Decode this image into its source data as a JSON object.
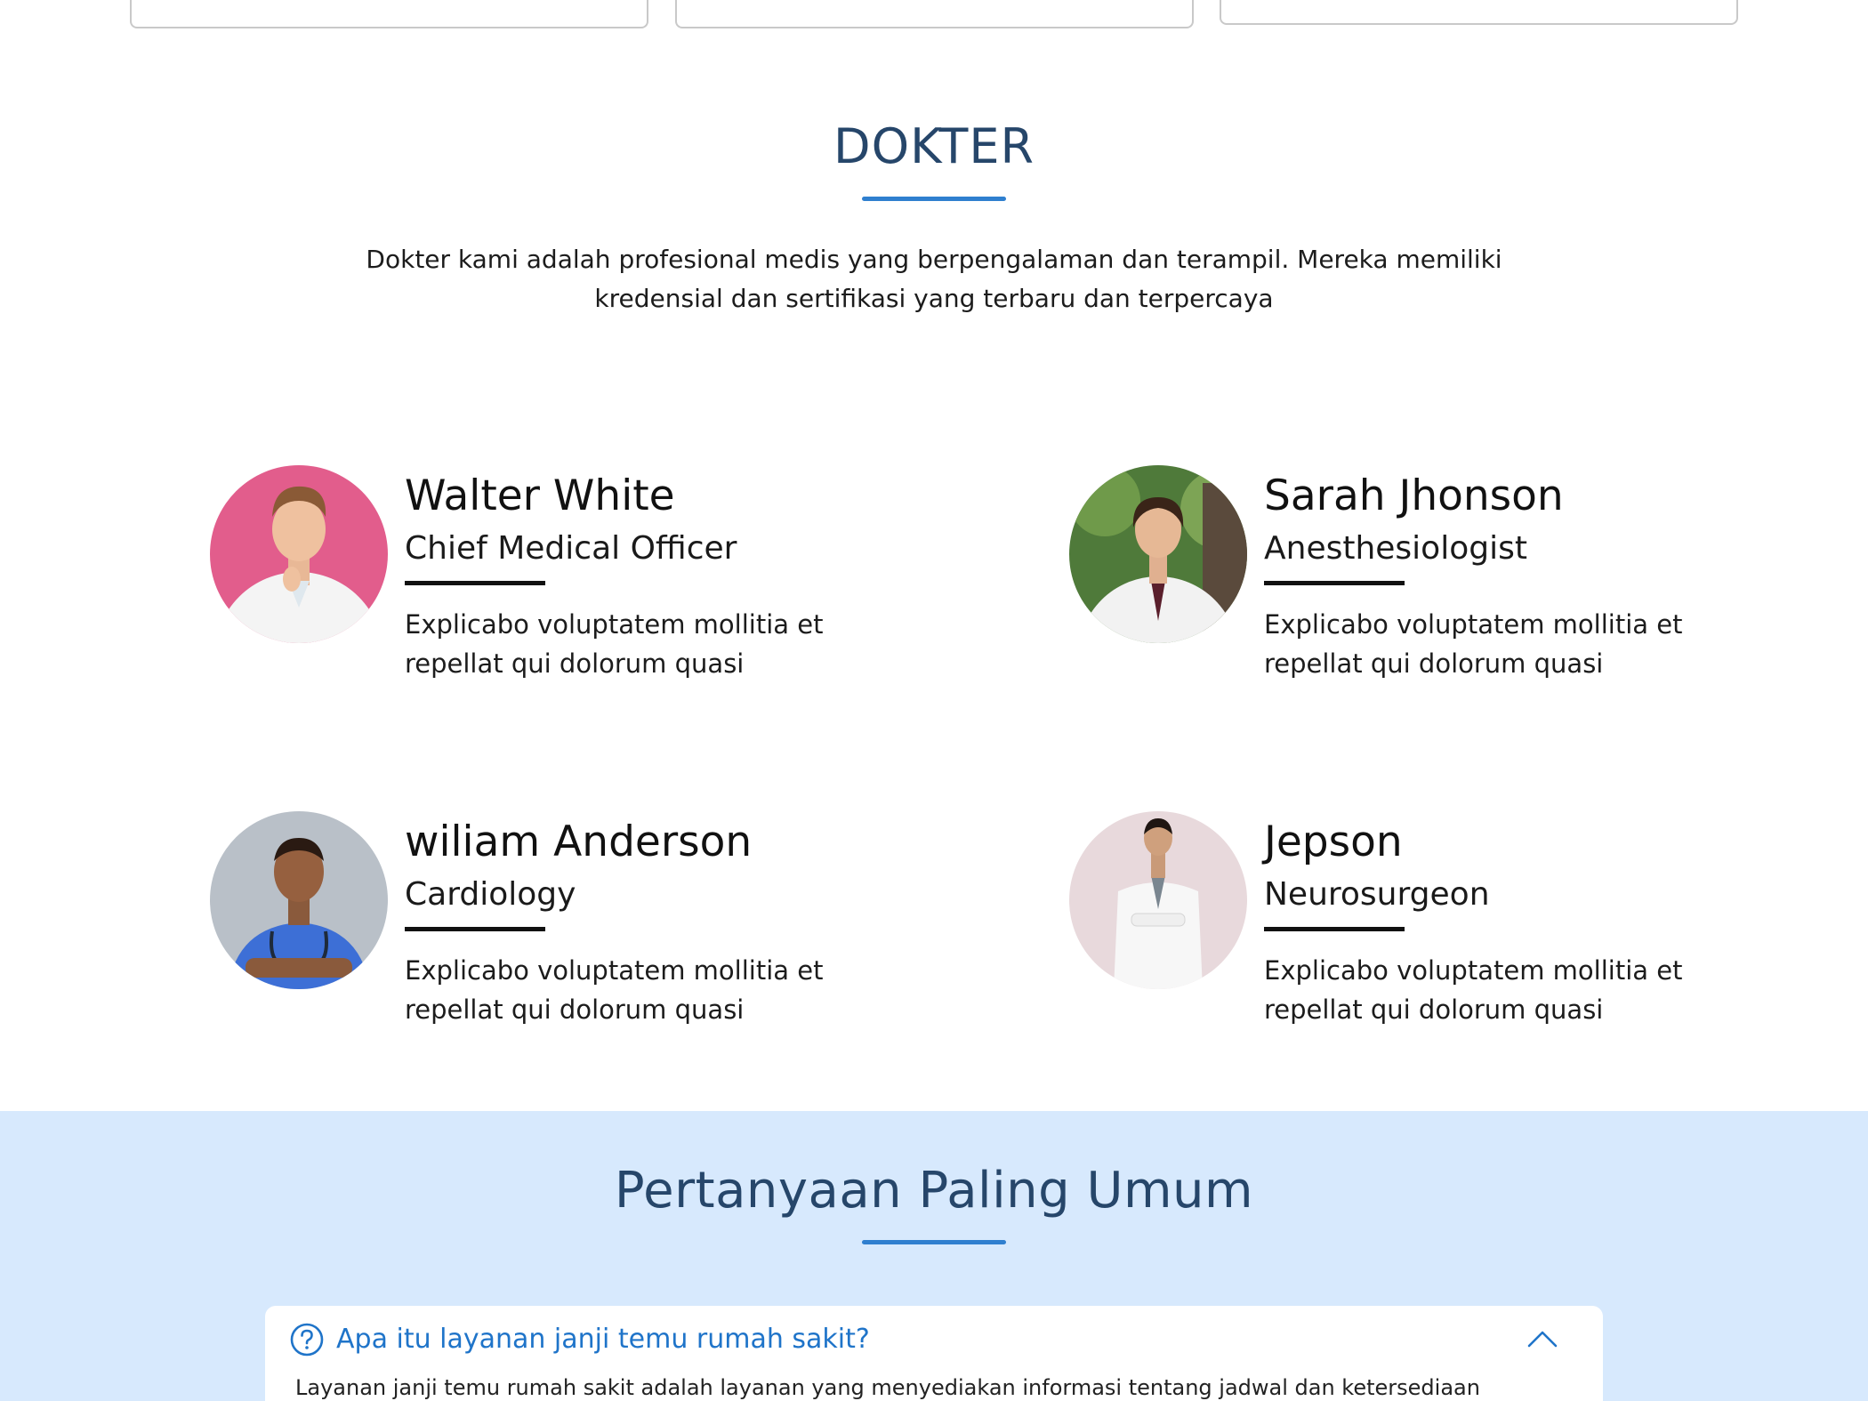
{
  "doctors_section": {
    "title": "DOKTER",
    "description": "Dokter kami adalah profesional medis yang berpengalaman dan terampil. Mereka memiliki kredensial dan sertifikasi yang terbaru dan terpercaya",
    "doctors": [
      {
        "name": "Walter White",
        "role": "Chief Medical Officer",
        "description": "Explicabo voluptatem mollitia et repellat qui dolorum quasi",
        "photo_bg": "#e25d8c"
      },
      {
        "name": "Sarah Jhonson",
        "role": "Anesthesiologist",
        "description": "Explicabo voluptatem mollitia et repellat qui dolorum quasi",
        "photo_bg": "#4f7a3a"
      },
      {
        "name": "wiliam Anderson",
        "role": "Cardiology",
        "description": "Explicabo voluptatem mollitia et repellat qui dolorum quasi",
        "photo_bg": "#b9c0c8"
      },
      {
        "name": "Jepson",
        "role": "Neurosurgeon",
        "description": "Explicabo voluptatem mollitia et repellat qui dolorum quasi",
        "photo_bg": "#e8d9dc"
      }
    ]
  },
  "faq_section": {
    "title": "Pertanyaan Paling Umum",
    "items": [
      {
        "question": "Apa itu layanan janji temu rumah sakit?",
        "answer": "Layanan janji temu rumah sakit adalah layanan yang menyediakan informasi tentang jadwal dan ketersediaan",
        "expanded": true,
        "icon": "question-circle-icon",
        "toggle_icon": "chevron-up-icon"
      }
    ]
  },
  "colors": {
    "heading": "#26466a",
    "accent": "#2f7fcf",
    "faq_background": "#d7e9fd",
    "faq_question": "#1f74c9"
  }
}
